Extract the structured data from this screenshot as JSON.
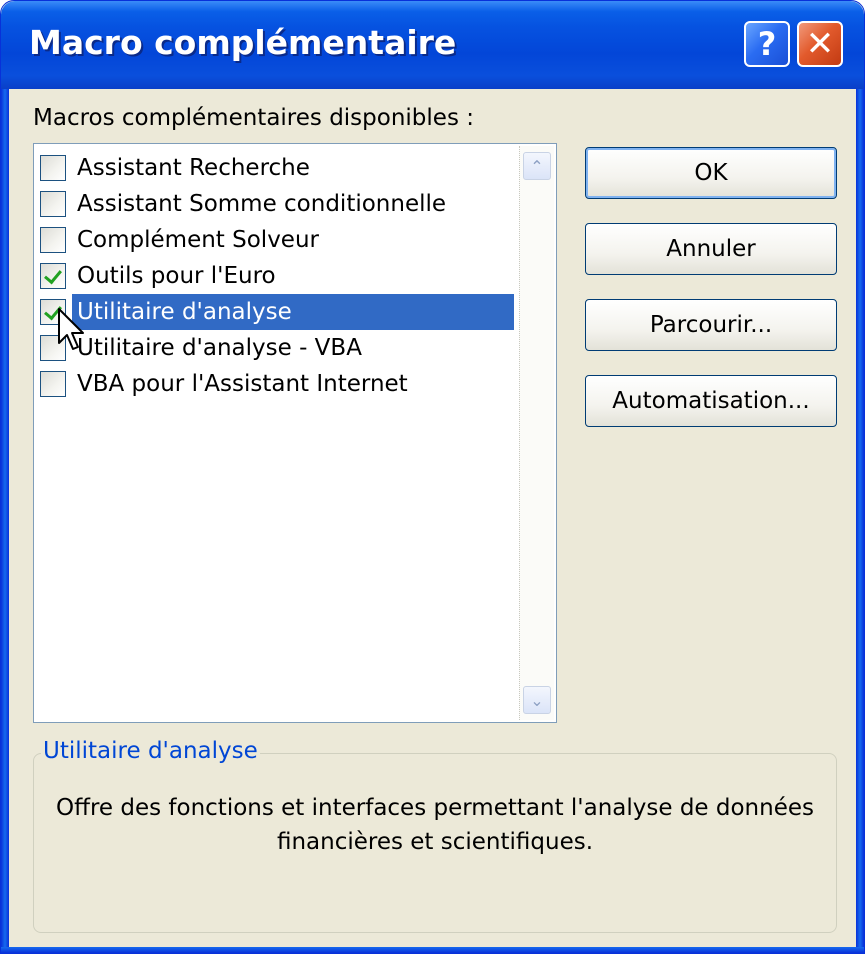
{
  "window": {
    "title": "Macro complémentaire",
    "help_glyph": "?",
    "close_glyph": "✕"
  },
  "list": {
    "label": "Macros complémentaires disponibles :",
    "items": [
      {
        "label": "Assistant Recherche",
        "checked": false,
        "selected": false
      },
      {
        "label": "Assistant Somme conditionnelle",
        "checked": false,
        "selected": false
      },
      {
        "label": "Complément Solveur",
        "checked": false,
        "selected": false
      },
      {
        "label": "Outils pour l'Euro",
        "checked": true,
        "selected": false
      },
      {
        "label": "Utilitaire d'analyse",
        "checked": true,
        "selected": true
      },
      {
        "label": "Utilitaire d'analyse - VBA",
        "checked": false,
        "selected": false
      },
      {
        "label": "VBA pour l'Assistant Internet",
        "checked": false,
        "selected": false
      }
    ],
    "scroll_up_glyph": "⌃",
    "scroll_down_glyph": "⌄"
  },
  "buttons": {
    "ok": "OK",
    "cancel": "Annuler",
    "browse": "Parcourir...",
    "automation": "Automatisation..."
  },
  "description": {
    "title": "Utilitaire d'analyse",
    "text": "Offre des fonctions et interfaces permettant l'analyse de données financières et scientifiques."
  },
  "colors": {
    "titlebar": "#0a5fe8",
    "dialog_bg": "#ece9d8",
    "selection": "#316ac5",
    "group_title": "#0046d5",
    "check": "#21a121"
  }
}
